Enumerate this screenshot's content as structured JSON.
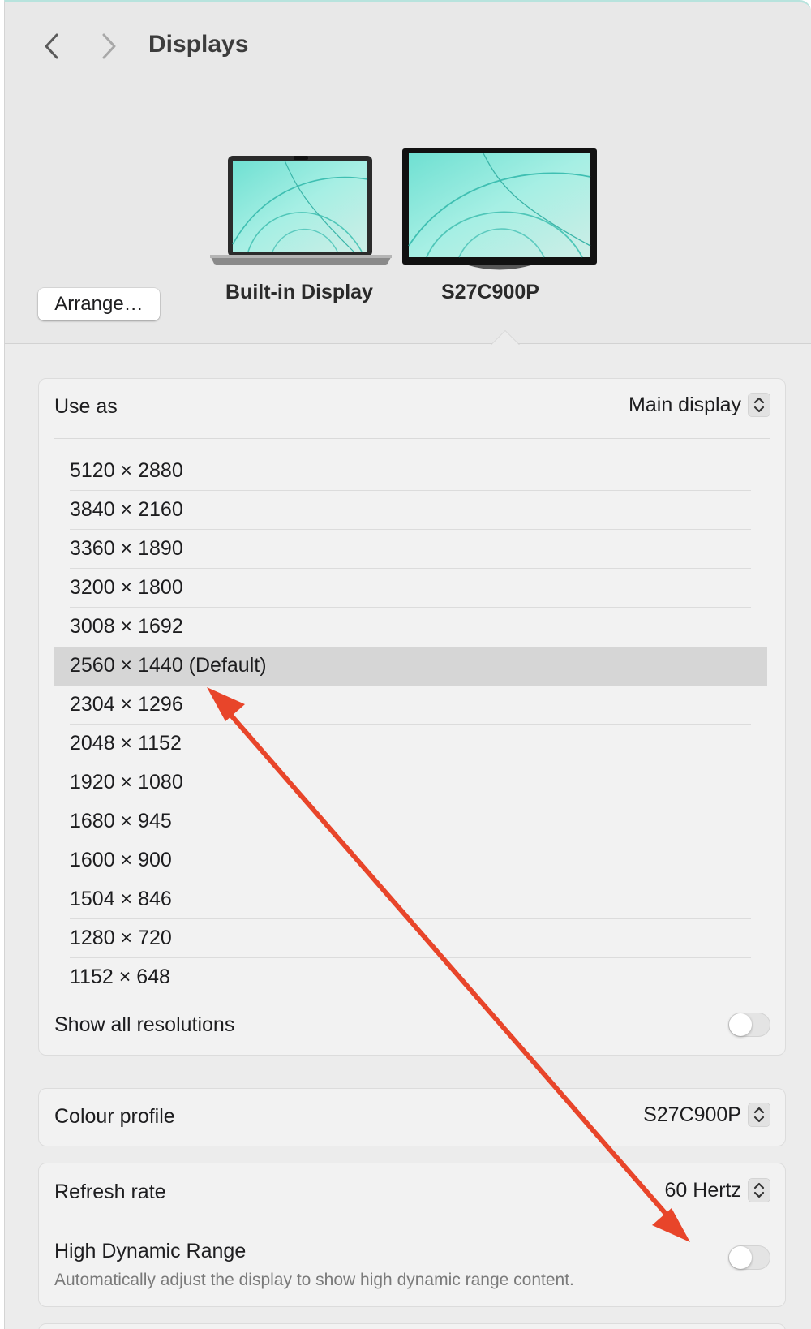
{
  "header": {
    "title": "Displays",
    "arrange_label": "Arrange…"
  },
  "displays": [
    {
      "name": "Built-in Display",
      "selected": false
    },
    {
      "name": "S27C900P",
      "selected": true
    }
  ],
  "use_as": {
    "label": "Use as",
    "value": "Main display"
  },
  "resolutions": [
    {
      "label": "5120 × 2880",
      "selected": false
    },
    {
      "label": "3840 × 2160",
      "selected": false
    },
    {
      "label": "3360 × 1890",
      "selected": false
    },
    {
      "label": "3200 × 1800",
      "selected": false
    },
    {
      "label": "3008 × 1692",
      "selected": false
    },
    {
      "label": "2560 × 1440 (Default)",
      "selected": true
    },
    {
      "label": "2304 × 1296",
      "selected": false
    },
    {
      "label": "2048 × 1152",
      "selected": false
    },
    {
      "label": "1920 × 1080",
      "selected": false
    },
    {
      "label": "1680 × 945",
      "selected": false
    },
    {
      "label": "1600 × 900",
      "selected": false
    },
    {
      "label": "1504 × 846",
      "selected": false
    },
    {
      "label": "1280 × 720",
      "selected": false
    },
    {
      "label": "1152 × 648",
      "selected": false
    }
  ],
  "show_all": {
    "label": "Show all resolutions",
    "on": false
  },
  "colour_profile": {
    "label": "Colour profile",
    "value": "S27C900P"
  },
  "refresh_rate": {
    "label": "Refresh rate",
    "value": "60 Hertz"
  },
  "hdr": {
    "label": "High Dynamic Range",
    "description": "Automatically adjust the display to show high dynamic range content.",
    "on": false
  },
  "colors": {
    "annotation_arrow": "#e8452a",
    "selected_row": "#d6d6d6",
    "wallpaper_teal": "#7fe3d6"
  },
  "icons": [
    "chevron-left-icon",
    "chevron-right-icon",
    "laptop-icon",
    "monitor-icon",
    "up-down-chevron-icon"
  ]
}
